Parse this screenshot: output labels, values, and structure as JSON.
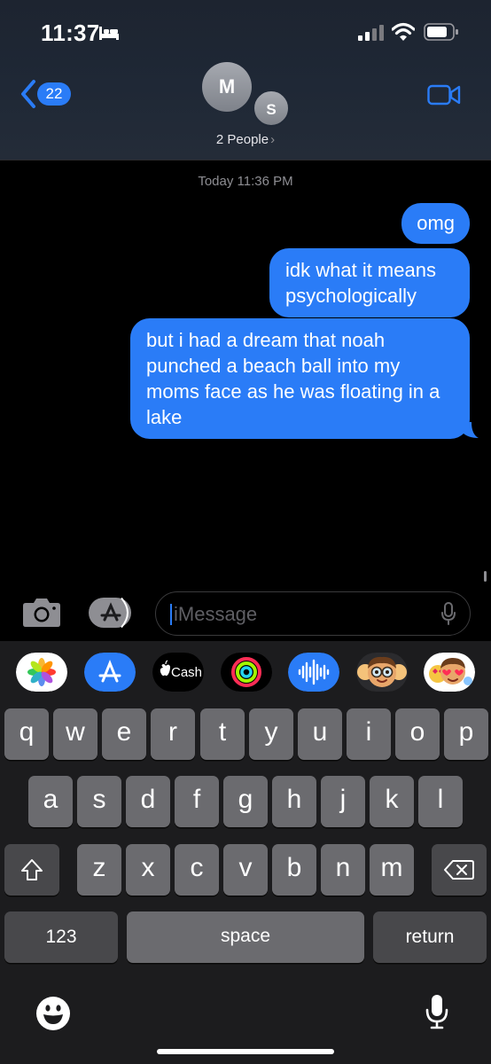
{
  "status_bar": {
    "time": "11:37"
  },
  "header": {
    "back_badge": "22",
    "avatar_1": "M",
    "avatar_2": "S",
    "people_label": "2 People",
    "chevron": "›"
  },
  "conversation": {
    "timestamp": "Today 11:36 PM",
    "messages": [
      {
        "text": "omg",
        "sender": "me"
      },
      {
        "text": "idk what it means psychologically",
        "sender": "me"
      },
      {
        "text": "but i had a dream that noah punched a beach ball into my moms face as he was floating in a lake",
        "sender": "me"
      }
    ]
  },
  "composer": {
    "placeholder": "iMessage"
  },
  "app_strip": [
    "photos-app",
    "app-store-app",
    "apple-cash-app",
    "activity-app",
    "audio-message-app",
    "memoji-app",
    "memoji-stickers-app"
  ],
  "app_strip_cash_label": "Cash",
  "keyboard": {
    "row1": [
      "q",
      "w",
      "e",
      "r",
      "t",
      "y",
      "u",
      "i",
      "o",
      "p"
    ],
    "row2": [
      "a",
      "s",
      "d",
      "f",
      "g",
      "h",
      "j",
      "k",
      "l"
    ],
    "row3": [
      "z",
      "x",
      "c",
      "v",
      "b",
      "n",
      "m"
    ],
    "numbers_label": "123",
    "space_label": "space",
    "return_label": "return"
  },
  "colors": {
    "bubble": "#2a7cf7",
    "key": "#6b6b6f",
    "key_dark": "#48484b",
    "keyboard_bg": "#1c1c1e"
  }
}
